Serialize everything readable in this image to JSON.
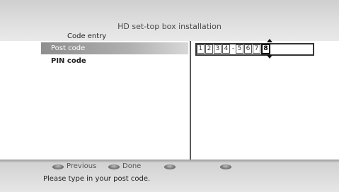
{
  "header": {
    "title": "HD set-top box installation",
    "section": "Code entry"
  },
  "menu": {
    "items": [
      {
        "label": "Post code",
        "selected": true
      },
      {
        "label": "PIN code",
        "selected": false
      }
    ]
  },
  "entry": {
    "digits_part1": [
      "1",
      "2",
      "3",
      "4"
    ],
    "separator": "-",
    "digits_part2": [
      "5",
      "6",
      "7",
      "8"
    ],
    "active_index": 7
  },
  "footer": {
    "buttons": [
      {
        "label": "Previous"
      },
      {
        "label": "Done"
      },
      {
        "label": ""
      },
      {
        "label": ""
      }
    ],
    "hint": "Please type in your post code."
  },
  "colors": {
    "selection_start": "#8e8e8e",
    "panel": "#ffffff",
    "background": "#d9d9d9"
  }
}
